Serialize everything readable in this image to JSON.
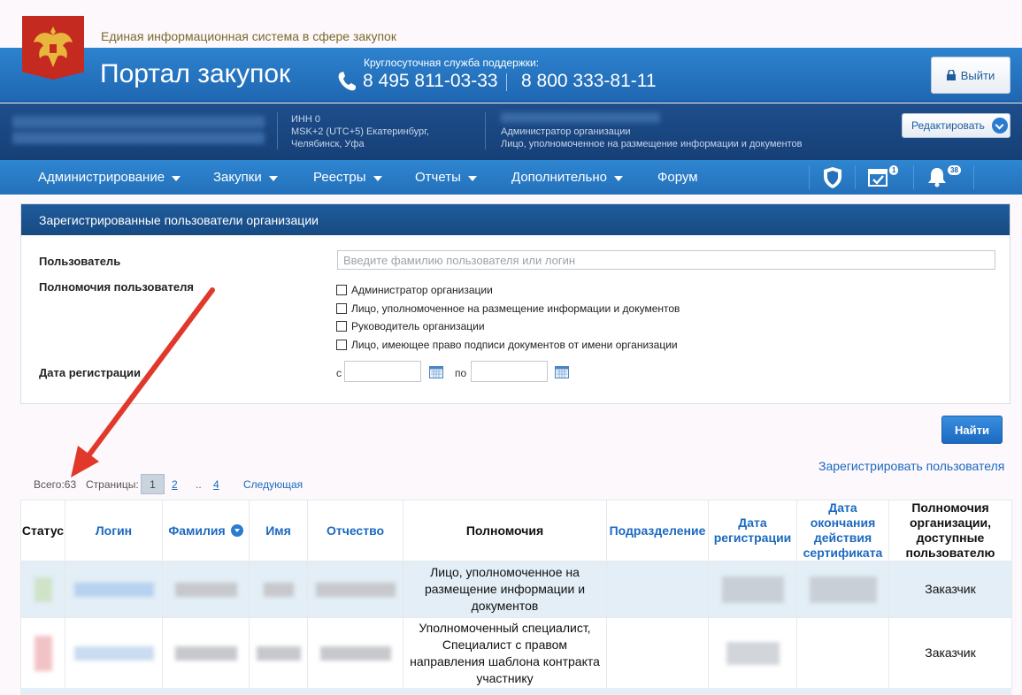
{
  "system_title": "Единая информационная система в сфере закупок",
  "header": {
    "portal_title": "Портал закупок",
    "support_label": "Круглосуточная служба поддержки:",
    "phone1": "8 495 811-03-33",
    "phone2": "8 800 333-81-11",
    "logout_label": "Выйти"
  },
  "userbar": {
    "inn": "ИНН 0",
    "timezone_line1": "MSK+2 (UTC+5) Екатеринбург,",
    "timezone_line2": "Челябинск, Уфа",
    "role_line1": "Администратор организации",
    "role_line2": "Лицо, уполномоченное на размещение информации и документов",
    "edit_label": "Редактировать"
  },
  "nav": {
    "items": [
      {
        "label": "Администрирование"
      },
      {
        "label": "Закупки"
      },
      {
        "label": "Реестры"
      },
      {
        "label": "Отчеты"
      },
      {
        "label": "Дополнительно"
      },
      {
        "label": "Форум"
      }
    ],
    "tasks_badge": "1",
    "notifications_badge": "38"
  },
  "panel": {
    "title": "Зарегистрированные пользователи организации",
    "user_label": "Пользователь",
    "user_placeholder": "Введите фамилию пользователя или логин",
    "rights_label": "Полномочия пользователя",
    "rights_options": [
      "Администратор организации",
      "Лицо, уполномоченное на размещение информации и документов",
      "Руководитель организации",
      "Лицо, имеющее право подписи документов от имени организации"
    ],
    "date_label": "Дата регистрации",
    "date_from": "с",
    "date_to": "по"
  },
  "find_label": "Найти",
  "register_link": "Зарегистрировать пользователя",
  "pager": {
    "total": "Всего:63",
    "pages_label": "Страницы:",
    "current": "1",
    "page2": "2",
    "dots": "..",
    "last": "4",
    "next": "Следующая"
  },
  "table": {
    "headers": {
      "status": "Статус",
      "login": "Логин",
      "surname": "Фамилия",
      "name": "Имя",
      "patronymic": "Отчество",
      "rights": "Полномочия",
      "department": "Подразделение",
      "reg_date": "Дата регистрации",
      "cert_end": "Дата окончания действия сертификата",
      "org_rights": "Полномочия организации, доступные пользователю"
    },
    "rows": [
      {
        "rights": "Лицо, уполномоченное на размещение информации и документов",
        "org_rights": "Заказчик"
      },
      {
        "rights": "Уполномоченный специалист, Специалист с правом направления шаблона контракта участнику",
        "org_rights": "Заказчик"
      }
    ]
  },
  "colors": {
    "header_blue": "#2470ba",
    "dark_blue": "#174a82",
    "link_blue": "#1c69c0",
    "annotation_arrow": "#e0392b",
    "emblem_red": "#c52a20"
  }
}
